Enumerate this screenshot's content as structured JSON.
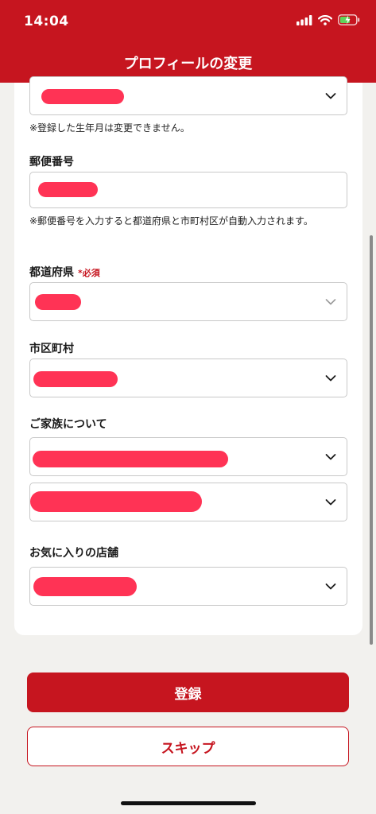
{
  "status_bar": {
    "time": "14:04"
  },
  "header": {
    "title": "プロフィールの変更"
  },
  "form": {
    "birth_note": "※登録した生年月は変更できません。",
    "postal": {
      "label": "郵便番号",
      "note": "※郵便番号を入力すると都道府県と市町村区が自動入力されます。"
    },
    "prefecture": {
      "label": "都道府県",
      "required": "*必須"
    },
    "city": {
      "label": "市区町村"
    },
    "family": {
      "label": "ご家族について"
    },
    "store": {
      "label": "お気に入りの店舗"
    }
  },
  "buttons": {
    "register": "登録",
    "skip": "スキップ"
  },
  "colors": {
    "brand_red": "#c6151f",
    "redaction": "#ff3355",
    "background": "#f2f1ee"
  }
}
